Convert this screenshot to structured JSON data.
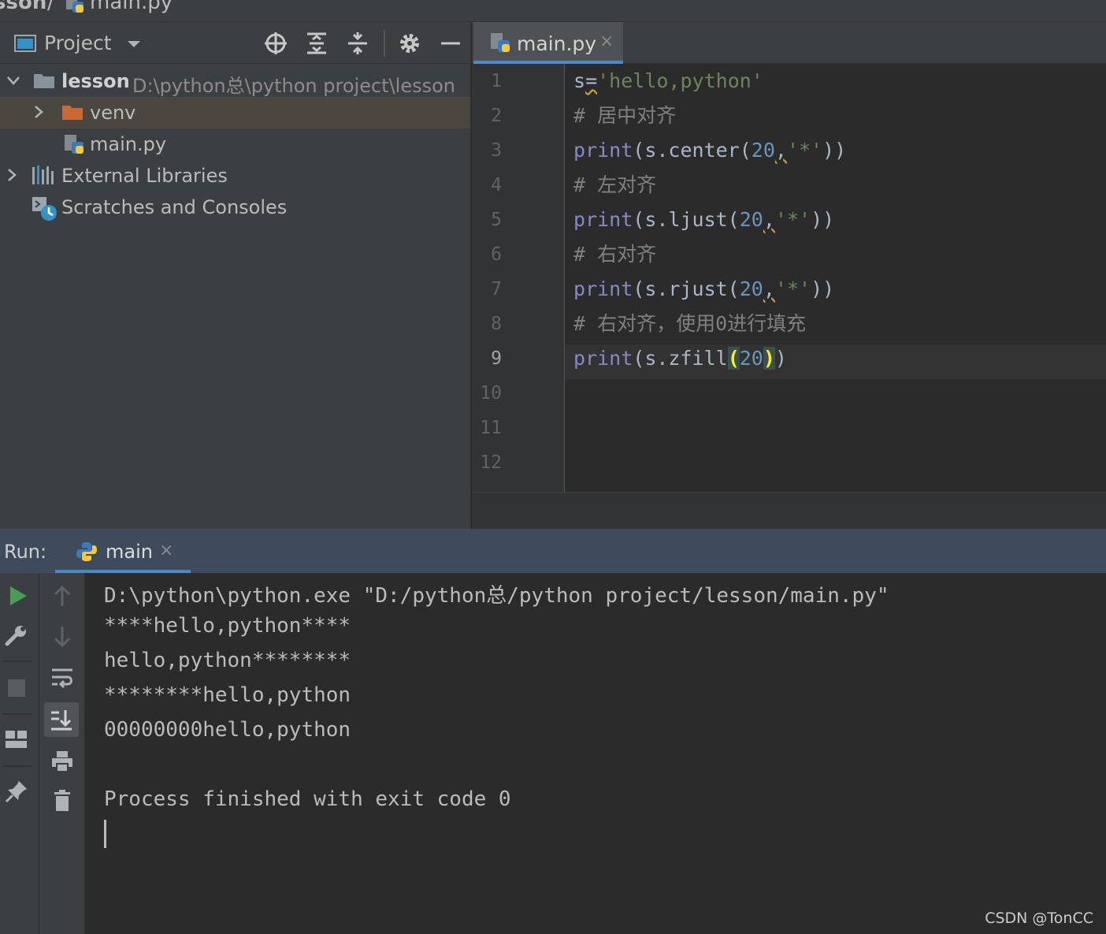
{
  "breadcrumb": {
    "root": "sson",
    "separator": "/",
    "file": "main.py"
  },
  "project_panel": {
    "title": "Project",
    "tree": [
      {
        "label": "lesson",
        "path": "D:\\python总\\python project\\lesson"
      },
      {
        "label": "venv"
      },
      {
        "label": "main.py"
      },
      {
        "label": "External Libraries"
      },
      {
        "label": "Scratches and Consoles"
      }
    ]
  },
  "editor": {
    "tab_label": "main.py",
    "tab_close": "×",
    "line_numbers": [
      "1",
      "2",
      "3",
      "4",
      "5",
      "6",
      "7",
      "8",
      "9",
      "10",
      "11",
      "12"
    ],
    "current_line": 9,
    "lines": [
      "s='hello,python'",
      "# 居中对齐",
      "print(s.center(20,'*'))",
      "# 左对齐",
      "print(s.ljust(20,'*'))",
      "# 右对齐",
      "print(s.rjust(20,'*'))",
      "# 右对齐，使用0进行填充",
      "print(s.zfill(20))"
    ]
  },
  "run_panel": {
    "label": "Run:",
    "tab_label": "main",
    "tab_close": "×",
    "output": [
      "D:\\python\\python.exe \"D:/python总/python project/lesson/main.py\"",
      "****hello,python****",
      "hello,python********",
      "********hello,python",
      "00000000hello,python",
      "",
      "Process finished with exit code 0"
    ]
  },
  "watermark": "CSDN @TonCC",
  "colors": {
    "keyword": "#8888c6",
    "string": "#6a8759",
    "number": "#6897bb",
    "comment": "#808080",
    "accent": "#4a88c7",
    "run_green": "#499c54"
  }
}
